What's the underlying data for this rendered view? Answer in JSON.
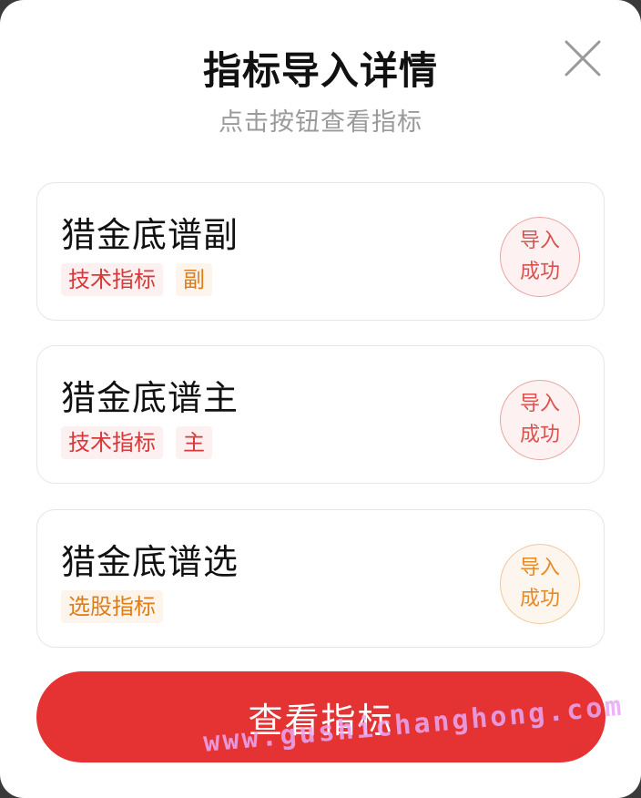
{
  "dialog": {
    "title": "指标导入详情",
    "subtitle": "点击按钮查看指标",
    "close_icon": "close-icon"
  },
  "cards": [
    {
      "title": "猎金底谱副",
      "tags": [
        {
          "label": "技术指标",
          "color": "#d63a3a"
        },
        {
          "label": "副",
          "color": "#e07d18"
        }
      ],
      "stamp": {
        "line1": "导入",
        "line2": "成功",
        "color": "#d9534f"
      }
    },
    {
      "title": "猎金底谱主",
      "tags": [
        {
          "label": "技术指标",
          "color": "#d63a3a"
        },
        {
          "label": "主",
          "color": "#d63a3a"
        }
      ],
      "stamp": {
        "line1": "导入",
        "line2": "成功",
        "color": "#d9534f"
      }
    },
    {
      "title": "猎金底谱选",
      "tags": [
        {
          "label": "选股指标",
          "color": "#e07d18"
        }
      ],
      "stamp": {
        "line1": "导入",
        "line2": "成功",
        "color": "#e58a2a"
      }
    }
  ],
  "action": {
    "label": "查看指标",
    "color": "#e53232"
  },
  "watermark": "www.gushichanghong.com"
}
